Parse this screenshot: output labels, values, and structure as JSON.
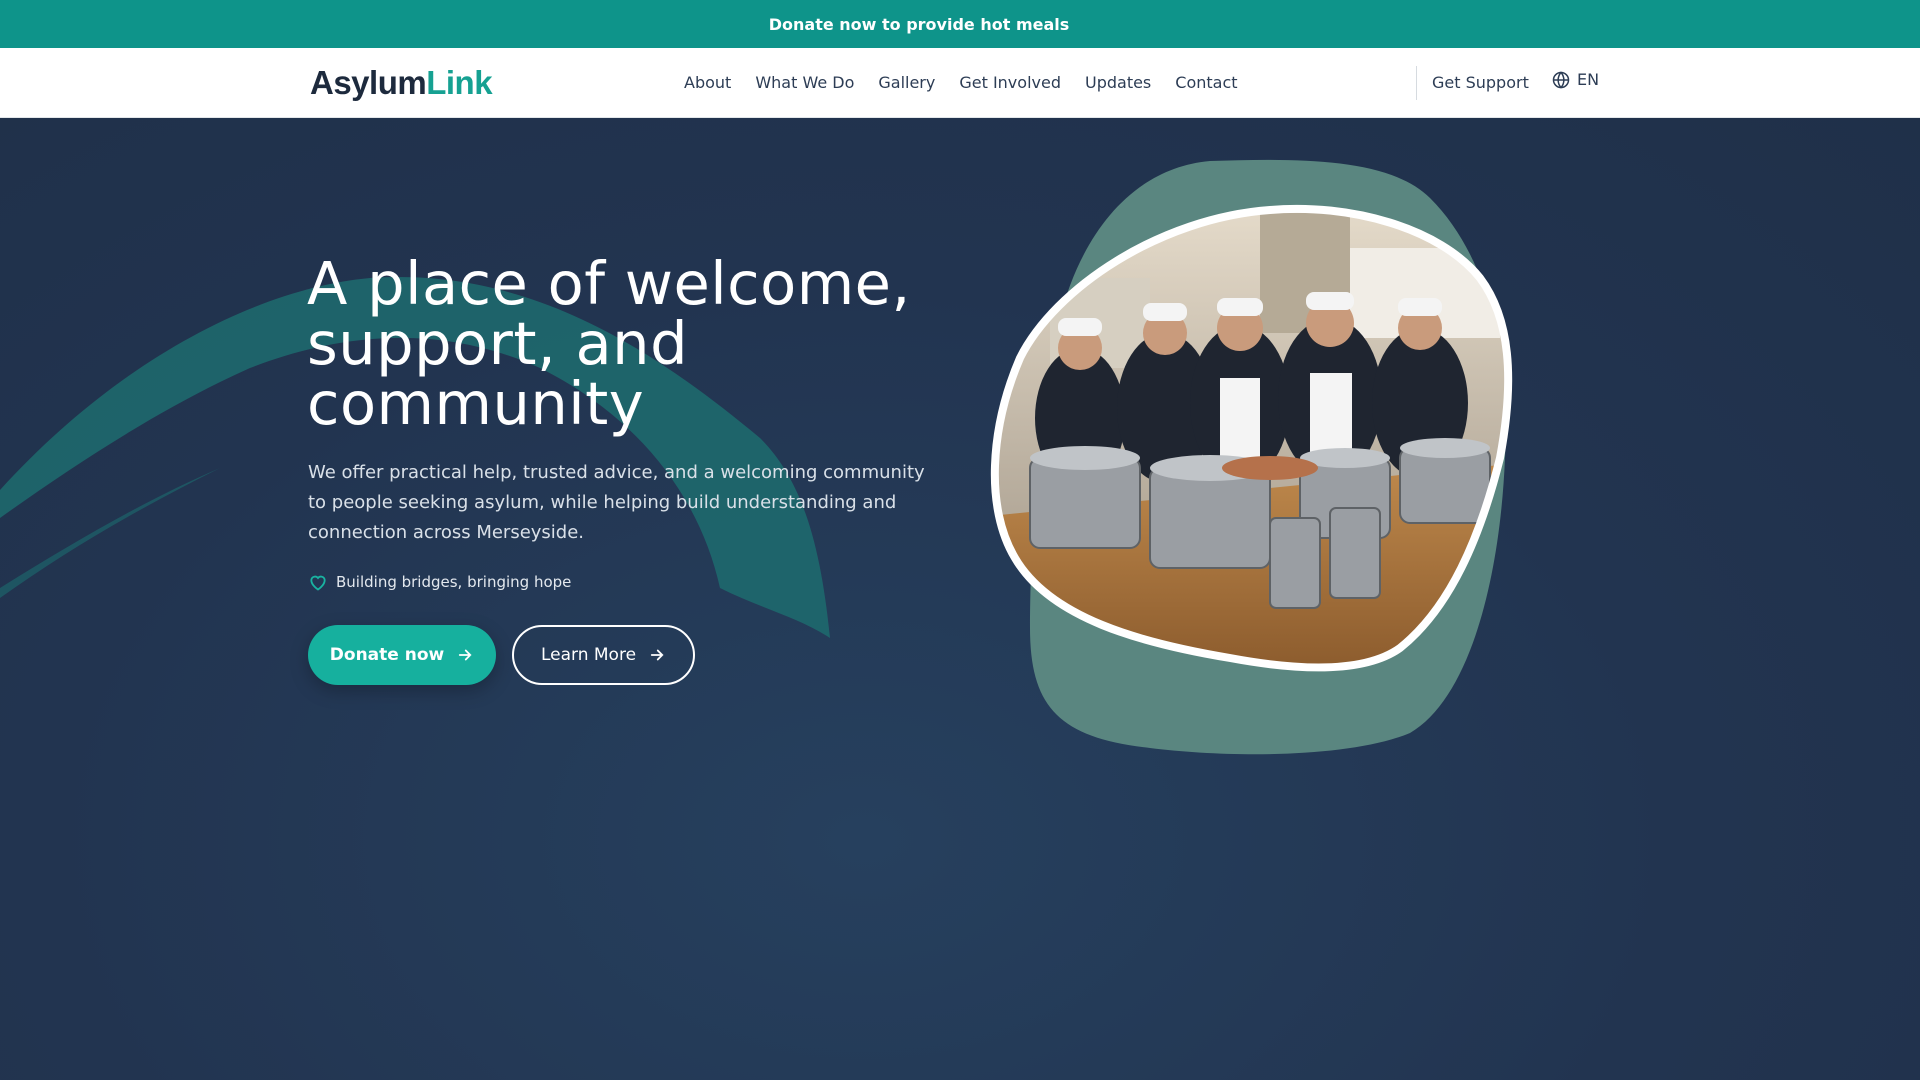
{
  "announcement": {
    "text": "Donate now to provide hot meals"
  },
  "header": {
    "logo": {
      "part1": "Asylum",
      "part2": "Link"
    },
    "nav": [
      "About",
      "What We Do",
      "Gallery",
      "Get Involved",
      "Updates",
      "Contact"
    ],
    "support_label": "Get Support",
    "language": "EN"
  },
  "hero": {
    "headline": "A place of welcome, support, and community",
    "lead": "We offer practical help, trusted advice, and a welcoming community to people seeking asylum, while helping build understanding and connection across Merseyside.",
    "tagline": "Building bridges, bringing hope",
    "donate_label": "Donate now",
    "learn_label": "Learn More"
  },
  "icons": {
    "tagline": "heart-icon",
    "language": "globe-icon",
    "buttons": "arrow-right-icon"
  },
  "colors": {
    "brand_teal": "#0e948a",
    "accent": "#16b09e",
    "hero_bg": "#223450",
    "blob": "#5a8680"
  }
}
